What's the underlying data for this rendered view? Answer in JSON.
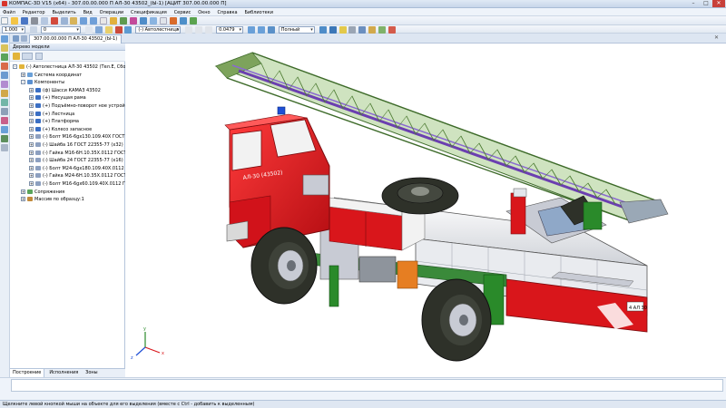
{
  "window": {
    "title": "КОМПАС-3D V15 (x64) - 307.00.00.000 П АЛ-30 43502_(Ы-1) [АЦИТ 307.00.00.000 П]",
    "controls": [
      "–",
      "□",
      "✕"
    ]
  },
  "menu": {
    "items": [
      "Файл",
      "Редактор",
      "Выделить",
      "Вид",
      "Операции",
      "Спецификация",
      "Сервис",
      "Окно",
      "Справка",
      "Библиотеки"
    ]
  },
  "toolbar": {
    "scale_value": "1.000",
    "layer_value": "0",
    "spec_value": "(-) Автолестница АЛ",
    "zoom_value": "0.0479",
    "mode_value": "Полный"
  },
  "document": {
    "tab_label": "307.00.00.000 П АЛ-30 43502_(Ы-1)"
  },
  "tree": {
    "header": "Дерево модели",
    "nodes": [
      {
        "label": "(-) Автолестница АЛ-30 43502 (Тел.Е, Сборочн",
        "level": 0,
        "expander": "-",
        "icon": "assembly-icon"
      },
      {
        "label": "Система координат",
        "level": 1,
        "expander": "+",
        "icon": "coordinate-system-icon"
      },
      {
        "label": "Компоненты",
        "level": 1,
        "expander": "-",
        "icon": "components-folder-icon"
      },
      {
        "label": "(ф) Шасси КАМАЗ 43502",
        "level": 2,
        "expander": "+",
        "icon": "component-icon"
      },
      {
        "label": "(+) Несущая рама",
        "level": 2,
        "expander": "+",
        "icon": "component-icon"
      },
      {
        "label": "(+) Подъёмно-поворот ное устройств",
        "level": 2,
        "expander": "+",
        "icon": "component-icon"
      },
      {
        "label": "(+) Лестница",
        "level": 2,
        "expander": "+",
        "icon": "component-icon"
      },
      {
        "label": "(+) Платформа",
        "level": 2,
        "expander": "+",
        "icon": "component-icon"
      },
      {
        "label": "(+) Колесо запасное",
        "level": 2,
        "expander": "+",
        "icon": "component-icon"
      },
      {
        "label": "(-) Болт М16-6gх130.109.40Х ГОСТ 7798",
        "level": 2,
        "expander": "+",
        "icon": "part-icon"
      },
      {
        "label": "(-) Шайба 16 ГОСТ 22355-77 (х32)",
        "level": 2,
        "expander": "+",
        "icon": "part-icon"
      },
      {
        "label": "(-) Гайка М16-6Н.10.35Х.0112 ГОСТ 591",
        "level": 2,
        "expander": "+",
        "icon": "part-icon"
      },
      {
        "label": "(-) Шайба 24 ГОСТ 22355-77 (х16)",
        "level": 2,
        "expander": "+",
        "icon": "part-icon"
      },
      {
        "label": "(-) Болт М24-6gх180.109.40Х.0112 ГОСТ",
        "level": 2,
        "expander": "+",
        "icon": "part-icon"
      },
      {
        "label": "(-) Гайка М24-6Н.10.35Х.0112 ГОСТ 591",
        "level": 2,
        "expander": "+",
        "icon": "part-icon"
      },
      {
        "label": "(-) Болт М16-6gх60.109.40Х.0112 ГОСТ 7",
        "level": 2,
        "expander": "+",
        "icon": "part-icon"
      },
      {
        "label": "Сопряжения",
        "level": 1,
        "expander": "+",
        "icon": "mates-icon"
      },
      {
        "label": "Массив по образцу:1",
        "level": 1,
        "expander": "+",
        "icon": "pattern-icon"
      }
    ],
    "tabs": [
      "Построение",
      "Исполнения",
      "Зоны"
    ]
  },
  "model": {
    "cab_text": "АЛ-30 (43502)",
    "plate_text": "4 АЛ 30",
    "axis_labels": [
      "x",
      "y",
      "z"
    ],
    "colors": {
      "cab": "#d9161b",
      "ladder": "#5a8a3a",
      "ladder_rail": "#6b3fb0",
      "tyre": "#2e3129",
      "frame": "#3a8a3a",
      "body_white": "#f2f2f2",
      "platform": "#c8cbd4"
    }
  },
  "status": {
    "text": "Щелкните левой кнопкой мыши на объекте для его выделения (вместе с Ctrl - добавить к выделенным)"
  }
}
